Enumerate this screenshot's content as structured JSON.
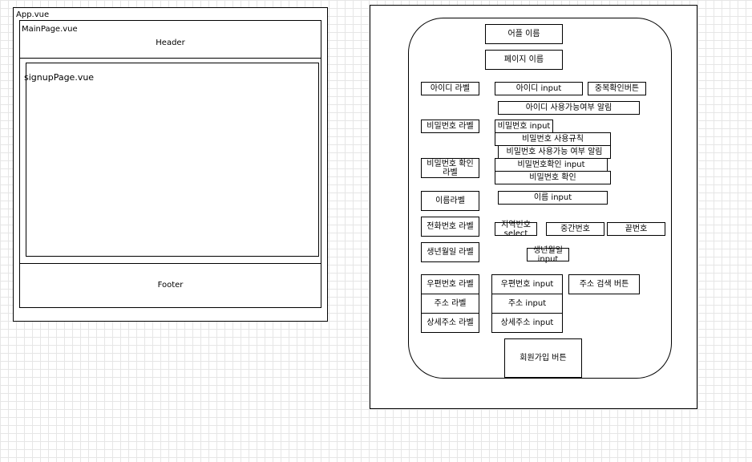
{
  "left_diagram": {
    "app": "App.vue",
    "main_page": "MainPage.vue",
    "header": "Header",
    "signup_page": "signupPage.vue",
    "footer": "Footer"
  },
  "right_diagram": {
    "app_name": "어플 이름",
    "page_name": "페이지 이름",
    "id_label": "아이디 라벨",
    "id_input": "아이디 input",
    "dup_check_button": "중복확인버튼",
    "id_availability_alert": "아이디 사용가능여부 알림",
    "password_label": "비밀번호 라벨",
    "password_input": "비밀번호 input",
    "password_rules": "비밀번호 사용규칙",
    "password_availability_alert": "비밀번호 사용가능 여부 알림",
    "password_confirm_label": "비밀번호 확인\n라벨",
    "password_confirm_input": "비밀번호확인 input",
    "password_confirm": "비밀번호 확인",
    "name_label": "이름라벨",
    "name_input": "이름 input",
    "phone_label": "전화번호 라벨",
    "area_code_select": "지역번호\nselect",
    "middle_number": "중간번호",
    "last_number": "끝번호",
    "birthdate_label": "생년월일 라벨",
    "birthdate_input": "생년월일\ninput",
    "zipcode_label": "우편번호 라벨",
    "zipcode_input": "우편번호 input",
    "address_search_button": "주소 검색 버튼",
    "address_label": "주소 라벨",
    "address_input": "주소 input",
    "detail_address_label": "상세주소 라벨",
    "detail_address_input": "상세주소 input",
    "signup_button": "회원가입 버튼"
  }
}
